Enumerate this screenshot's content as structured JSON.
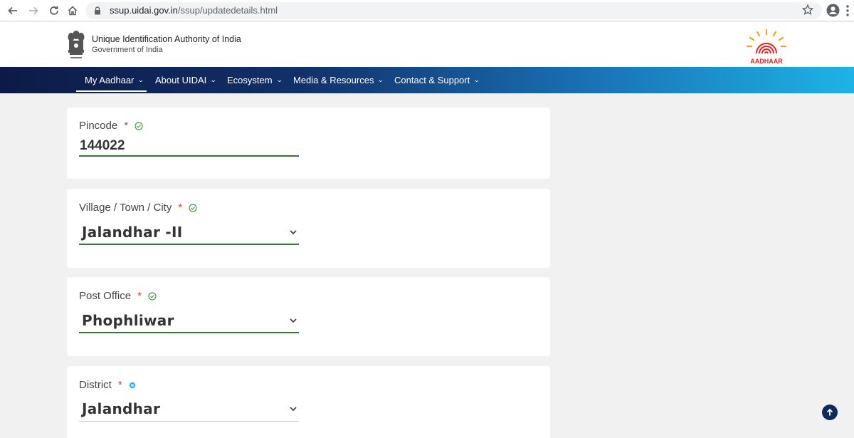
{
  "browser": {
    "url_domain": "ssup.uidai.gov.in",
    "url_path": "/ssup/updatedetails.html"
  },
  "header": {
    "org_name": "Unique Identification Authority of India",
    "gov_name": "Government of India",
    "logo_text": "AADHAAR"
  },
  "nav": {
    "items": [
      {
        "label": "My Aadhaar"
      },
      {
        "label": "About UIDAI"
      },
      {
        "label": "Ecosystem"
      },
      {
        "label": "Media & Resources"
      },
      {
        "label": "Contact & Support"
      }
    ],
    "chevron": "⌄",
    "active_index": 0
  },
  "form": {
    "required_mark": "*",
    "pincode": {
      "label": "Pincode",
      "value": "144022",
      "status": "verified"
    },
    "city": {
      "label": "Village / Town / City",
      "value": "Jalandhar -II",
      "status": "verified"
    },
    "post_office": {
      "label": "Post Office",
      "value": "Phophliwar",
      "status": "verified"
    },
    "district": {
      "label": "District",
      "value": "Jalandhar",
      "status": "pending"
    }
  },
  "colors": {
    "verified": "#43a047",
    "required": "#e53935",
    "pending": "#29b6f6",
    "nav_start": "#0d1a47",
    "nav_end": "#1eb3e6"
  }
}
